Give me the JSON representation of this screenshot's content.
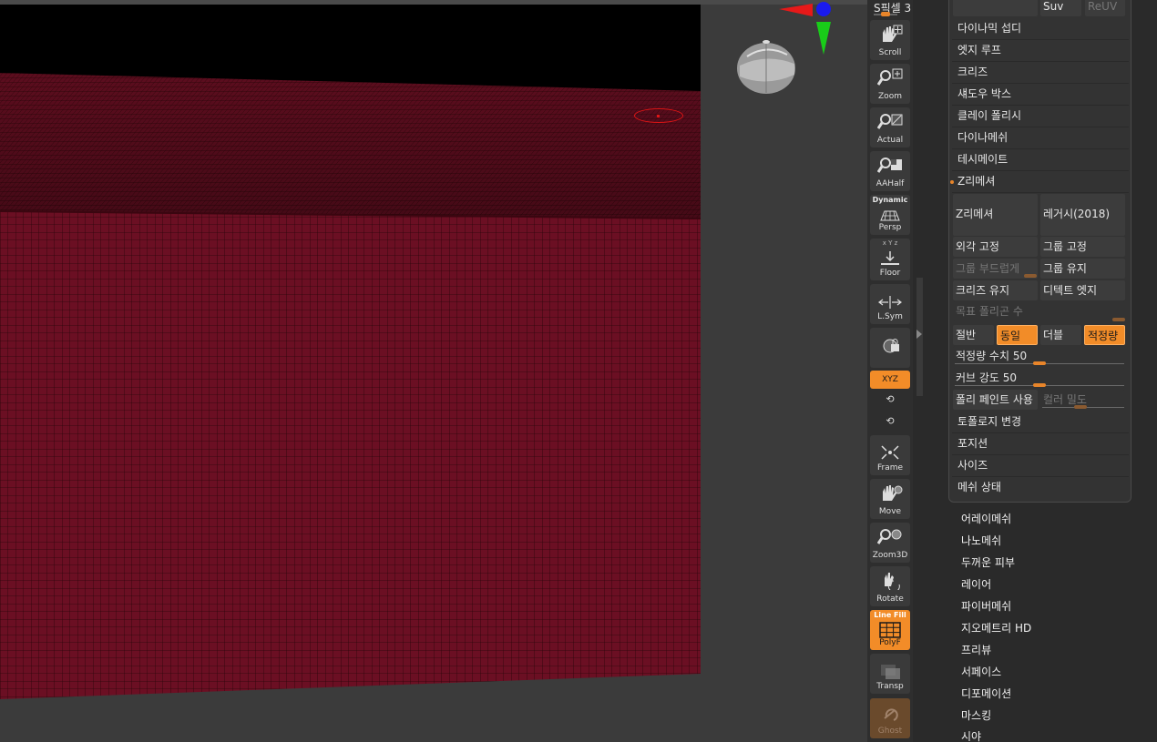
{
  "viewport": {
    "mesh_color": "#6b0f23",
    "wire_color": "#2a0509",
    "brush_color": "#e01515"
  },
  "gizmo": {
    "x_color": "#e61919",
    "y_color": "#19cc19",
    "z_color": "#1a1aee"
  },
  "shelf": {
    "spix_label": "S픽셀 3",
    "buttons": [
      {
        "label": "Scroll",
        "icon": "hand-scroll-icon"
      },
      {
        "label": "Zoom",
        "icon": "zoom-icon"
      },
      {
        "label": "Actual",
        "icon": "actual-size-icon"
      },
      {
        "label": "AAHalf",
        "icon": "aahalf-icon"
      },
      {
        "label": "Persp",
        "top": "Dynamic",
        "icon": "perspective-icon"
      },
      {
        "label": "Floor",
        "top": "x Y z",
        "icon": "floor-icon"
      },
      {
        "label": "L.Sym",
        "icon": "local-symmetry-icon"
      },
      {
        "label": "",
        "icon": "lock-camera-icon"
      },
      {
        "label": "Frame",
        "icon": "frame-icon"
      },
      {
        "label": "Move",
        "icon": "hand-move-icon"
      },
      {
        "label": "Zoom3D",
        "icon": "zoom3d-icon"
      },
      {
        "label": "Rotate",
        "icon": "rotate-icon"
      },
      {
        "label": "PolyF",
        "top": "Line Fill",
        "icon": "polyframe-icon"
      },
      {
        "label": "Transp",
        "icon": "transparency-icon"
      },
      {
        "label": "Ghost",
        "icon": "ghost-icon"
      }
    ],
    "xyz_label": "XYZ"
  },
  "palette": {
    "top_cells": {
      "left": "",
      "suv": "Suv",
      "reuv": "ReUV"
    },
    "sections": [
      "다이나믹 섭디",
      "엣지 루프",
      "크리즈",
      "섀도우 박스",
      "클레이 폴리시",
      "다이나메쉬",
      "테시메이트"
    ],
    "zremesher": {
      "header": "Z리메셔",
      "main_button": "Z리메셔",
      "legacy_button": "레거시(2018)",
      "keep_borders": "외각 고정",
      "keep_groups": "그룹 고정",
      "smooth_groups": "그룹 부드럽게",
      "keep_polypaint_groups": "그룹 유지",
      "keep_creases": "크리즈 유지",
      "detect_edges": "디텍트 엣지",
      "target_polys": "목표 폴리곤 수",
      "half": "절반",
      "same": "동일",
      "double": "더블",
      "adaptive": "적정량",
      "adaptive_size_label": "적정량 수치 50",
      "adaptive_size_value": 50,
      "curve_strength_label": "커브 강도 50",
      "curve_strength_value": 50,
      "use_polypaint": "폴리 페인트 사용",
      "color_density": "컬러 밀도"
    },
    "after": [
      "토폴로지 변경",
      "포지션",
      "사이즈",
      "메쉬 상태"
    ],
    "outer_items": [
      "어레이메쉬",
      "나노메쉬",
      "두꺼운 피부",
      "레이어",
      "파이버메쉬",
      "지오메트리 HD",
      "프리뷰",
      "서페이스",
      "디포메이션",
      "마스킹",
      "시야"
    ]
  }
}
